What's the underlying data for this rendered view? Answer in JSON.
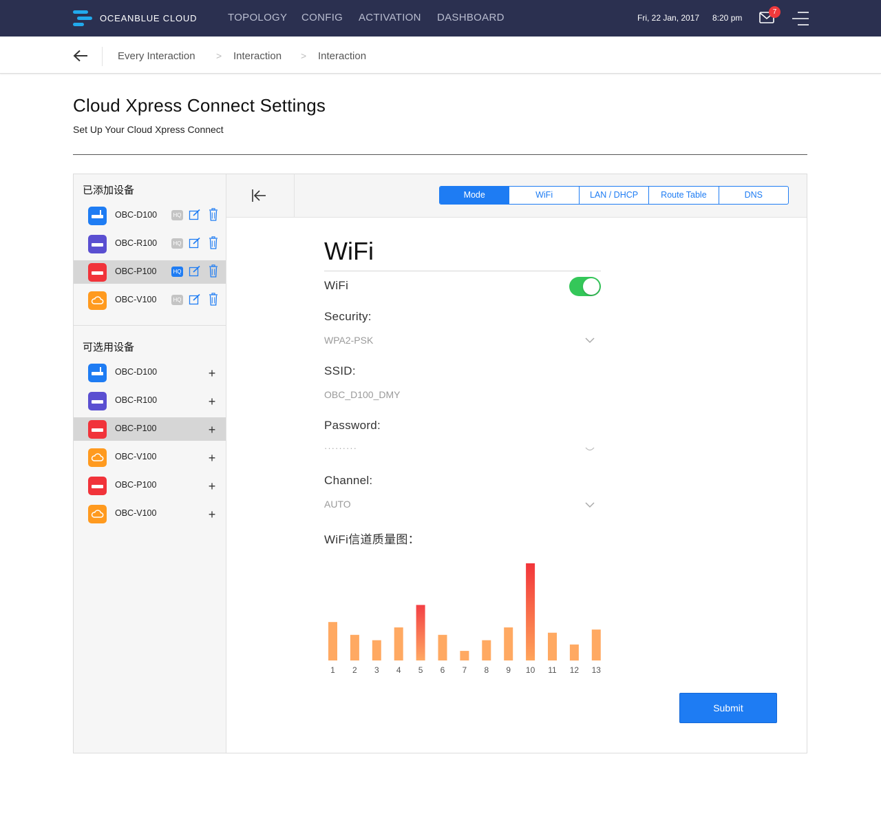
{
  "brand": "OCEANBLUE CLOUD",
  "nav": [
    {
      "label": "TOPOLOGY",
      "active": true
    },
    {
      "label": "CONFIG",
      "active": false
    },
    {
      "label": "ACTIVATION",
      "active": false
    },
    {
      "label": "DASHBOARD",
      "active": false
    }
  ],
  "date": "Fri, 22 Jan, 2017",
  "time": "8:20 pm",
  "notifications": "7",
  "breadcrumb": [
    "Every Interaction",
    "Interaction",
    "Interaction"
  ],
  "breadcrumb_sep": ">",
  "page": {
    "title": "Cloud Xpress Connect Settings",
    "subtitle": "Set Up Your Cloud Xpress Connect"
  },
  "sidebar": {
    "added_title": "已添加设备",
    "available_title": "可选用设备",
    "hq_label": "HQ",
    "added": [
      {
        "name": "OBC-D100",
        "icon": "router-icon",
        "color": "blue",
        "hq": false,
        "selected": false
      },
      {
        "name": "OBC-R100",
        "icon": "switch-icon",
        "color": "purple",
        "hq": false,
        "selected": false
      },
      {
        "name": "OBC-P100",
        "icon": "firewall-icon",
        "color": "red",
        "hq": true,
        "selected": true
      },
      {
        "name": "OBC-V100",
        "icon": "cloud-icon",
        "color": "orange",
        "hq": false,
        "selected": false
      }
    ],
    "available": [
      {
        "name": "OBC-D100",
        "icon": "router-icon",
        "color": "blue",
        "selected": false
      },
      {
        "name": "OBC-R100",
        "icon": "switch-icon",
        "color": "purple",
        "selected": false
      },
      {
        "name": "OBC-P100",
        "icon": "firewall-icon",
        "color": "red",
        "selected": true
      },
      {
        "name": "OBC-V100",
        "icon": "cloud-icon",
        "color": "orange",
        "selected": false
      },
      {
        "name": "OBC-P100",
        "icon": "firewall-icon",
        "color": "red",
        "selected": false
      },
      {
        "name": "OBC-V100",
        "icon": "cloud-icon",
        "color": "orange",
        "selected": false
      }
    ],
    "add_symbol": "+"
  },
  "tabs": [
    {
      "label": "Mode",
      "active": true
    },
    {
      "label": "WiFi",
      "active": false
    },
    {
      "label": "LAN / DHCP",
      "active": false
    },
    {
      "label": "Route Table",
      "active": false
    },
    {
      "label": "DNS",
      "active": false
    }
  ],
  "form": {
    "title": "WiFi",
    "wifi_label": "WiFi",
    "wifi_enabled": true,
    "security_label": "Security:",
    "security_value": "WPA2-PSK",
    "ssid_label": "SSID:",
    "ssid_value": "OBC_D100_DMY",
    "password_label": "Password:",
    "password_value": "·········",
    "channel_label": "Channel:",
    "channel_value": "AUTO",
    "chart_label": "WiFi信道质量图：",
    "submit_label": "Submit"
  },
  "colors": {
    "nav_bg": "#2b3050",
    "accent": "#1e7cf3",
    "toggle_on": "#34c759",
    "bar_low": "#ffa45a",
    "bar_high": "#f2353a"
  },
  "chart_data": {
    "type": "bar",
    "categories": [
      "1",
      "2",
      "3",
      "4",
      "5",
      "6",
      "7",
      "8",
      "9",
      "10",
      "11",
      "12",
      "13"
    ],
    "values": [
      36,
      24,
      19,
      31,
      52,
      24,
      9,
      19,
      31,
      91,
      26,
      15,
      29
    ],
    "title": "",
    "xlabel": "",
    "ylabel": "",
    "ylim": [
      0,
      100
    ],
    "grid": false,
    "legend": "none"
  }
}
